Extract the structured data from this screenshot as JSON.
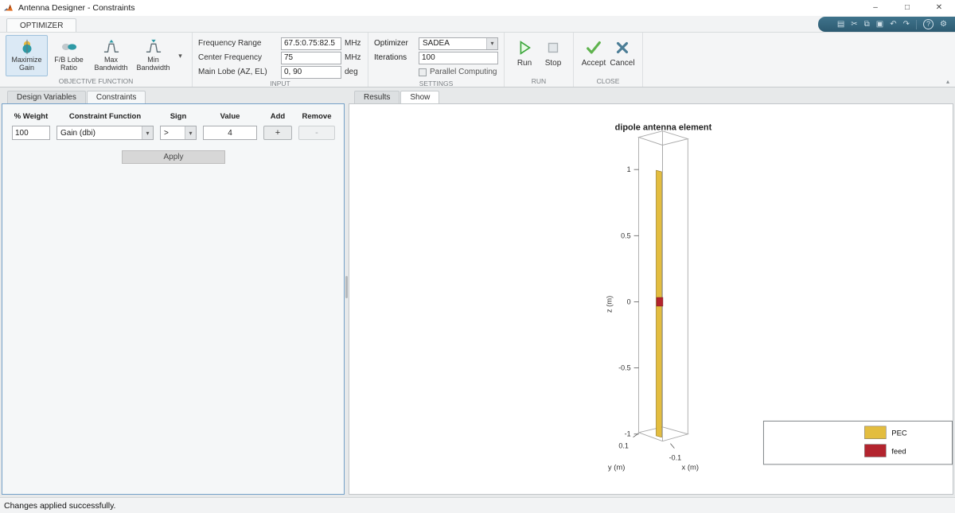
{
  "window": {
    "title": "Antenna Designer - Constraints"
  },
  "icons": {
    "chevron_down": "▾",
    "collapse_ribbon": "▴",
    "minimize": "–",
    "maximize": "□",
    "close": "✕",
    "save": "▤",
    "cut": "✂",
    "copy": "⧉",
    "paste": "▣",
    "undo": "↶",
    "redo": "↷",
    "help": "?",
    "gear": "⚙"
  },
  "ribbon": {
    "tab_label": "OPTIMIZER",
    "objective": {
      "section_label": "OBJECTIVE FUNCTION",
      "maximize_gain_label": "Maximize Gain",
      "fb_lobe_label": "F/B Lobe Ratio",
      "max_bandwidth_label": "Max Bandwidth",
      "min_bandwidth_label": "Min Bandwidth"
    },
    "input": {
      "section_label": "INPUT",
      "frequency_range": {
        "label": "Frequency Range",
        "value": "67.5:0.75:82.5",
        "unit": "MHz"
      },
      "center_frequency": {
        "label": "Center Frequency",
        "value": "75",
        "unit": "MHz"
      },
      "main_lobe": {
        "label": "Main Lobe (AZ, EL)",
        "value": "0, 90",
        "unit": "deg"
      }
    },
    "settings": {
      "section_label": "SETTINGS",
      "optimizer_label": "Optimizer",
      "optimizer_value": "SADEA",
      "iterations_label": "Iterations",
      "iterations_value": "100",
      "parallel_computing_label": "Parallel Computing"
    },
    "run": {
      "section_label": "RUN",
      "run_label": "Run",
      "stop_label": "Stop"
    },
    "close": {
      "section_label": "CLOSE",
      "accept_label": "Accept",
      "cancel_label": "Cancel"
    }
  },
  "left_panel": {
    "tabs": [
      "Design Variables",
      "Constraints"
    ],
    "active_tab": "Constraints",
    "table": {
      "headers": [
        "% Weight",
        "Constraint Function",
        "Sign",
        "Value",
        "Add",
        "Remove"
      ],
      "row": {
        "weight": "100",
        "constraint_function": "Gain (dbi)",
        "sign": ">",
        "value": "4",
        "add_label": "+",
        "remove_label": "-"
      }
    },
    "apply_label": "Apply"
  },
  "right_panel": {
    "tabs": [
      "Results",
      "Show"
    ],
    "active_tab": "Show",
    "plot": {
      "title": "dipole antenna element",
      "x_label": "x (m)",
      "y_label": "y (m)",
      "z_label": "z (m)",
      "z_ticks": [
        "1",
        "0.5",
        "0",
        "-0.5",
        "-1"
      ],
      "y_tick": "0.1",
      "x_tick": "-0.1",
      "legend": [
        {
          "label": "PEC",
          "color": "#e3bd3f"
        },
        {
          "label": "feed",
          "color": "#b3242e"
        }
      ]
    }
  },
  "status_bar": {
    "message": "Changes applied successfully."
  }
}
